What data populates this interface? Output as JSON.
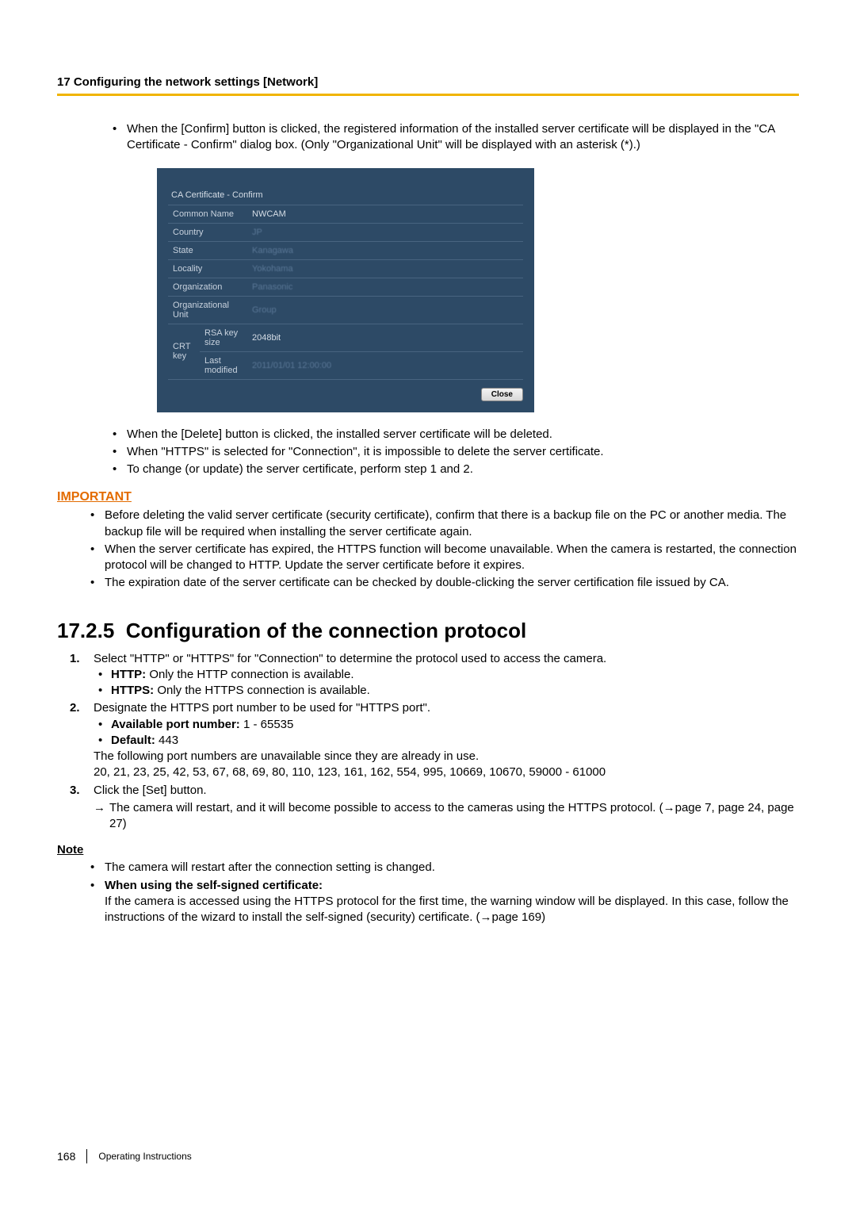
{
  "header": {
    "title": "17 Configuring the network settings [Network]"
  },
  "intro_bullets": [
    "When the [Confirm] button is clicked, the registered information of the installed server certificate will be displayed in the \"CA Certificate - Confirm\" dialog box. (Only \"Organizational Unit\" will be displayed with an asterisk (*).)"
  ],
  "dialog": {
    "title": "CA Certificate - Confirm",
    "rows": {
      "common_name": {
        "label": "Common Name",
        "value": "NWCAM"
      },
      "country": {
        "label": "Country",
        "value": "JP"
      },
      "state": {
        "label": "State",
        "value": "Kanagawa"
      },
      "locality": {
        "label": "Locality",
        "value": "Yokohama"
      },
      "organization": {
        "label": "Organization",
        "value": "Panasonic"
      },
      "org_unit": {
        "label": "Organizational Unit",
        "value": "Group"
      },
      "crt": {
        "label": "CRT key",
        "rsa": {
          "label": "RSA key size",
          "value": "2048bit"
        },
        "last": {
          "label": "Last modified",
          "value": "2011/01/01 12:00:00"
        }
      }
    },
    "close_label": "Close"
  },
  "after_dialog_bullets": [
    "When the [Delete] button is clicked, the installed server certificate will be deleted.",
    "When \"HTTPS\" is selected for \"Connection\", it is impossible to delete the server certificate.",
    "To change (or update) the server certificate, perform step 1 and 2."
  ],
  "important": {
    "heading": "IMPORTANT",
    "bullets": [
      "Before deleting the valid server certificate (security certificate), confirm that there is a backup file on the PC or another media. The backup file will be required when installing the server certificate again.",
      "When the server certificate has expired, the HTTPS function will become unavailable. When the camera is restarted, the connection protocol will be changed to HTTP. Update the server certificate before it expires.",
      "The expiration date of the server certificate can be checked by double-clicking the server certification file issued by CA."
    ]
  },
  "section": {
    "number": "17.2.5",
    "title": "Configuration of the connection protocol"
  },
  "steps": {
    "s1": {
      "text": "Select \"HTTP\" or \"HTTPS\" for \"Connection\" to determine the protocol used to access the camera.",
      "sub": [
        {
          "boldpart": "HTTP:",
          "rest": " Only the HTTP connection is available."
        },
        {
          "boldpart": "HTTPS:",
          "rest": " Only the HTTPS connection is available."
        }
      ]
    },
    "s2": {
      "text": "Designate the HTTPS port number to be used for \"HTTPS port\".",
      "sub": [
        {
          "boldpart": "Available port number:",
          "rest": " 1 - 65535"
        },
        {
          "boldpart": "Default:",
          "rest": " 443"
        }
      ],
      "after1": "The following port numbers are unavailable since they are already in use.",
      "after2": "20, 21, 23, 25, 42, 53, 67, 68, 69, 80, 110, 123, 161, 162, 554, 995, 10669, 10670, 59000 - 61000"
    },
    "s3": {
      "text": "Click the [Set] button.",
      "arrow": "The camera will restart, and it will become possible to access to the cameras using the HTTPS protocol. (→page 7, page 24, page 27)"
    }
  },
  "note": {
    "heading": "Note",
    "b1": "The camera will restart after the connection setting is changed.",
    "b2bold": "When using the self-signed certificate:",
    "b2rest": "If the camera is accessed using the HTTPS protocol for the first time, the warning window will be displayed. In this case, follow the instructions of the wizard to install the self-signed (security) certificate. (→page 169)"
  },
  "footer": {
    "page": "168",
    "doc": "Operating Instructions"
  }
}
